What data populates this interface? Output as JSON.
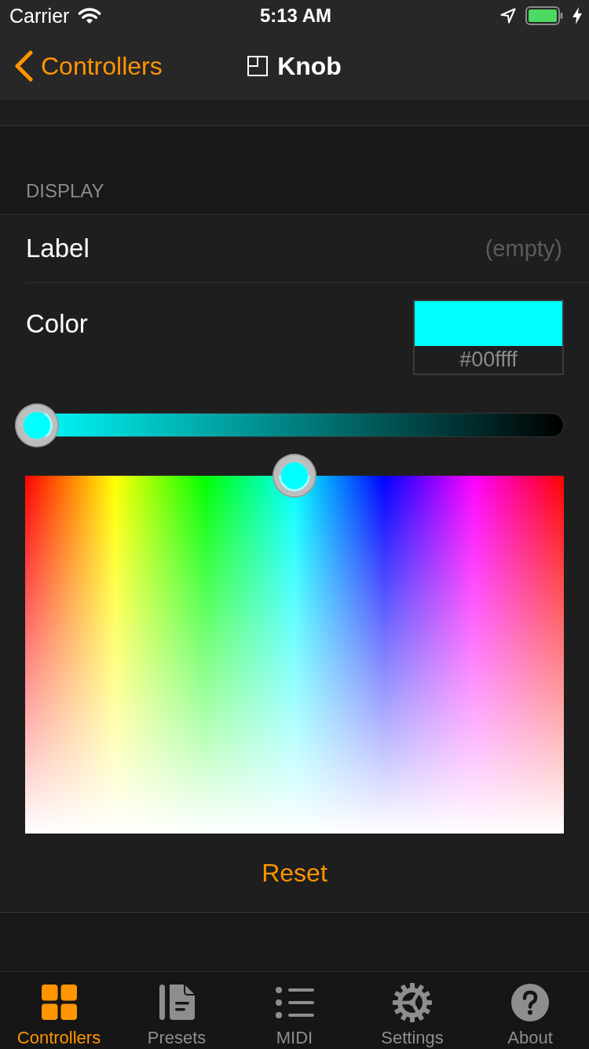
{
  "status_bar": {
    "carrier": "Carrier",
    "time": "5:13 AM"
  },
  "nav_bar": {
    "back_label": "Controllers",
    "title": "Knob"
  },
  "display_section": {
    "header": "DISPLAY",
    "label_field": {
      "label": "Label",
      "placeholder": "(empty)"
    },
    "color_field": {
      "label": "Color",
      "color": "#00ffff",
      "hex": "#00ffff",
      "brightness_slider": {
        "level": 0
      },
      "hue_picker": {
        "level": 0.5
      }
    },
    "reset_button": "Reset"
  },
  "tab_bar": {
    "items": [
      {
        "label": "Controllers",
        "selected": true
      },
      {
        "label": "Presets",
        "selected": false
      },
      {
        "label": "MIDI",
        "selected": false
      },
      {
        "label": "Settings",
        "selected": false
      },
      {
        "label": "About",
        "selected": false
      }
    ]
  }
}
